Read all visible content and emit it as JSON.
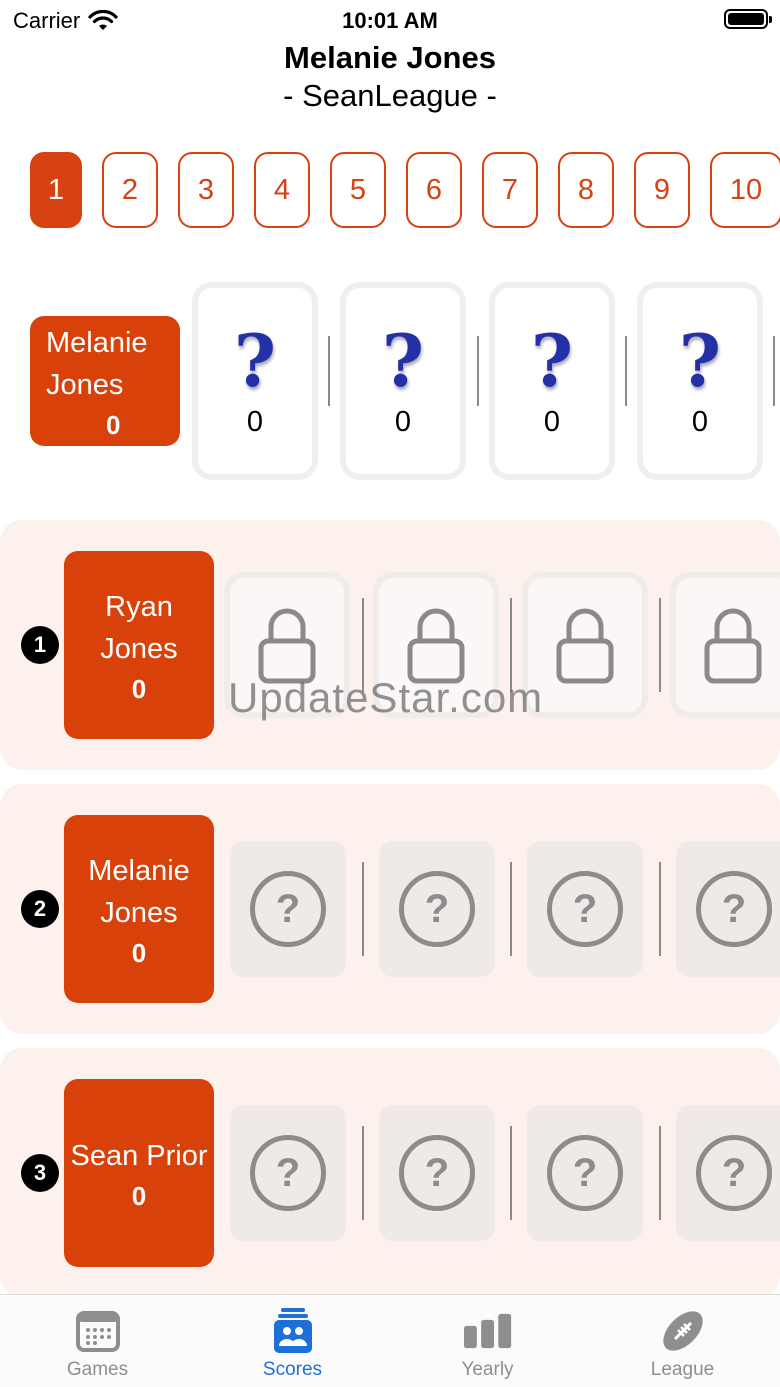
{
  "status_bar": {
    "carrier": "Carrier",
    "time": "10:01 AM"
  },
  "header": {
    "title": "Melanie Jones",
    "subtitle": "- SeanLeague -"
  },
  "weeks": [
    "1",
    "2",
    "3",
    "4",
    "5",
    "6",
    "7",
    "8",
    "9",
    "10"
  ],
  "active_week": "1",
  "current_user": {
    "first": "Melanie",
    "last": "Jones",
    "score": "0",
    "picks": [
      {
        "label": "?",
        "score": "0"
      },
      {
        "label": "?",
        "score": "0"
      },
      {
        "label": "?",
        "score": "0"
      },
      {
        "label": "?",
        "score": "0"
      }
    ]
  },
  "standings": [
    {
      "rank": "1",
      "first": "Ryan",
      "last": "Jones",
      "score": "0",
      "pick_state": "locked"
    },
    {
      "rank": "2",
      "first": "Melanie",
      "last": "Jones",
      "score": "0",
      "pick_state": "unknown"
    },
    {
      "rank": "3",
      "name": "Sean Prior",
      "score": "0",
      "pick_state": "unknown"
    }
  ],
  "watermark": "UpdateStar.com",
  "tabs": [
    {
      "label": "Games",
      "icon": "calendar-icon"
    },
    {
      "label": "Scores",
      "icon": "scores-icon"
    },
    {
      "label": "Yearly",
      "icon": "bar-chart-icon"
    },
    {
      "label": "League",
      "icon": "football-icon"
    }
  ],
  "colors": {
    "accent": "#d9410b",
    "tab_active": "#1f6fd9",
    "row_bg": "#fdf1ee",
    "qmark": "#2330a6"
  }
}
